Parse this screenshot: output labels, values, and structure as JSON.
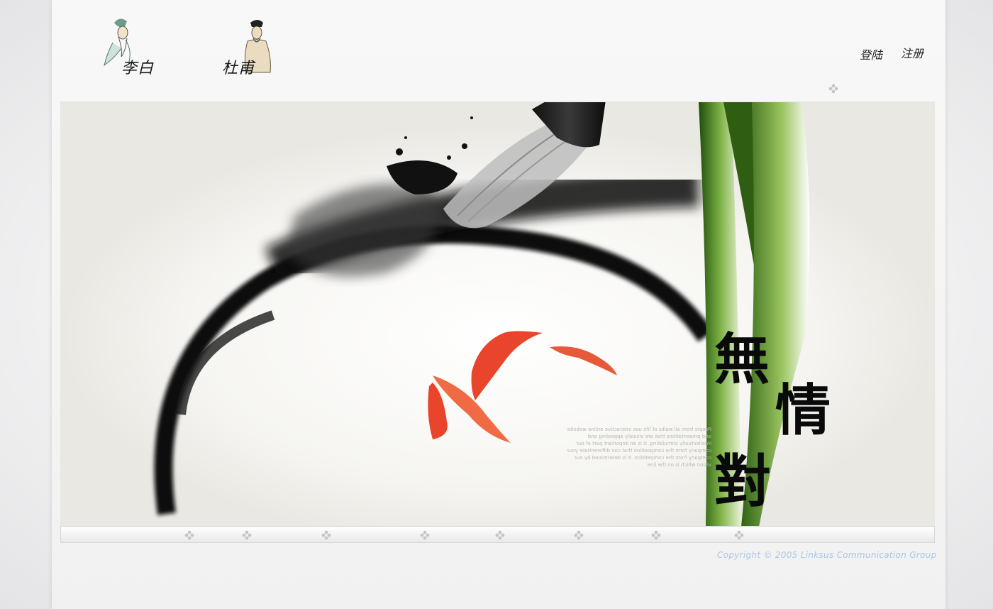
{
  "poets": [
    {
      "name": "李白"
    },
    {
      "name": "杜甫"
    }
  ],
  "auth": {
    "login_label": "登陆",
    "register_label": "注册"
  },
  "banner": {
    "calligraphy": [
      "無",
      "情",
      "對"
    ],
    "mirrored_text": "People from all walks of life use interactive online website and presentations that are visually appealing and intellectually stimulating. It is an important part of our company form the composition that can differentiate your company from the competition. It is determined by our vision which is on the line"
  },
  "footer": {
    "copyright": "Copyright © 2005  Linksus Communication Group"
  },
  "colors": {
    "page_bg": "#f4f4f5",
    "banner_bg": "#f7f6f1",
    "ink": "#0a0a0a",
    "koi": "#e8452c",
    "reed_green": "#4f8a1f",
    "copyright": "#a9c7e6"
  },
  "icons": [
    "poet-libai-icon",
    "poet-dufu-icon",
    "diamond-dot-icon",
    "brush-icon",
    "koi-fish-icon",
    "reed-icon",
    "ink-circle-icon"
  ]
}
